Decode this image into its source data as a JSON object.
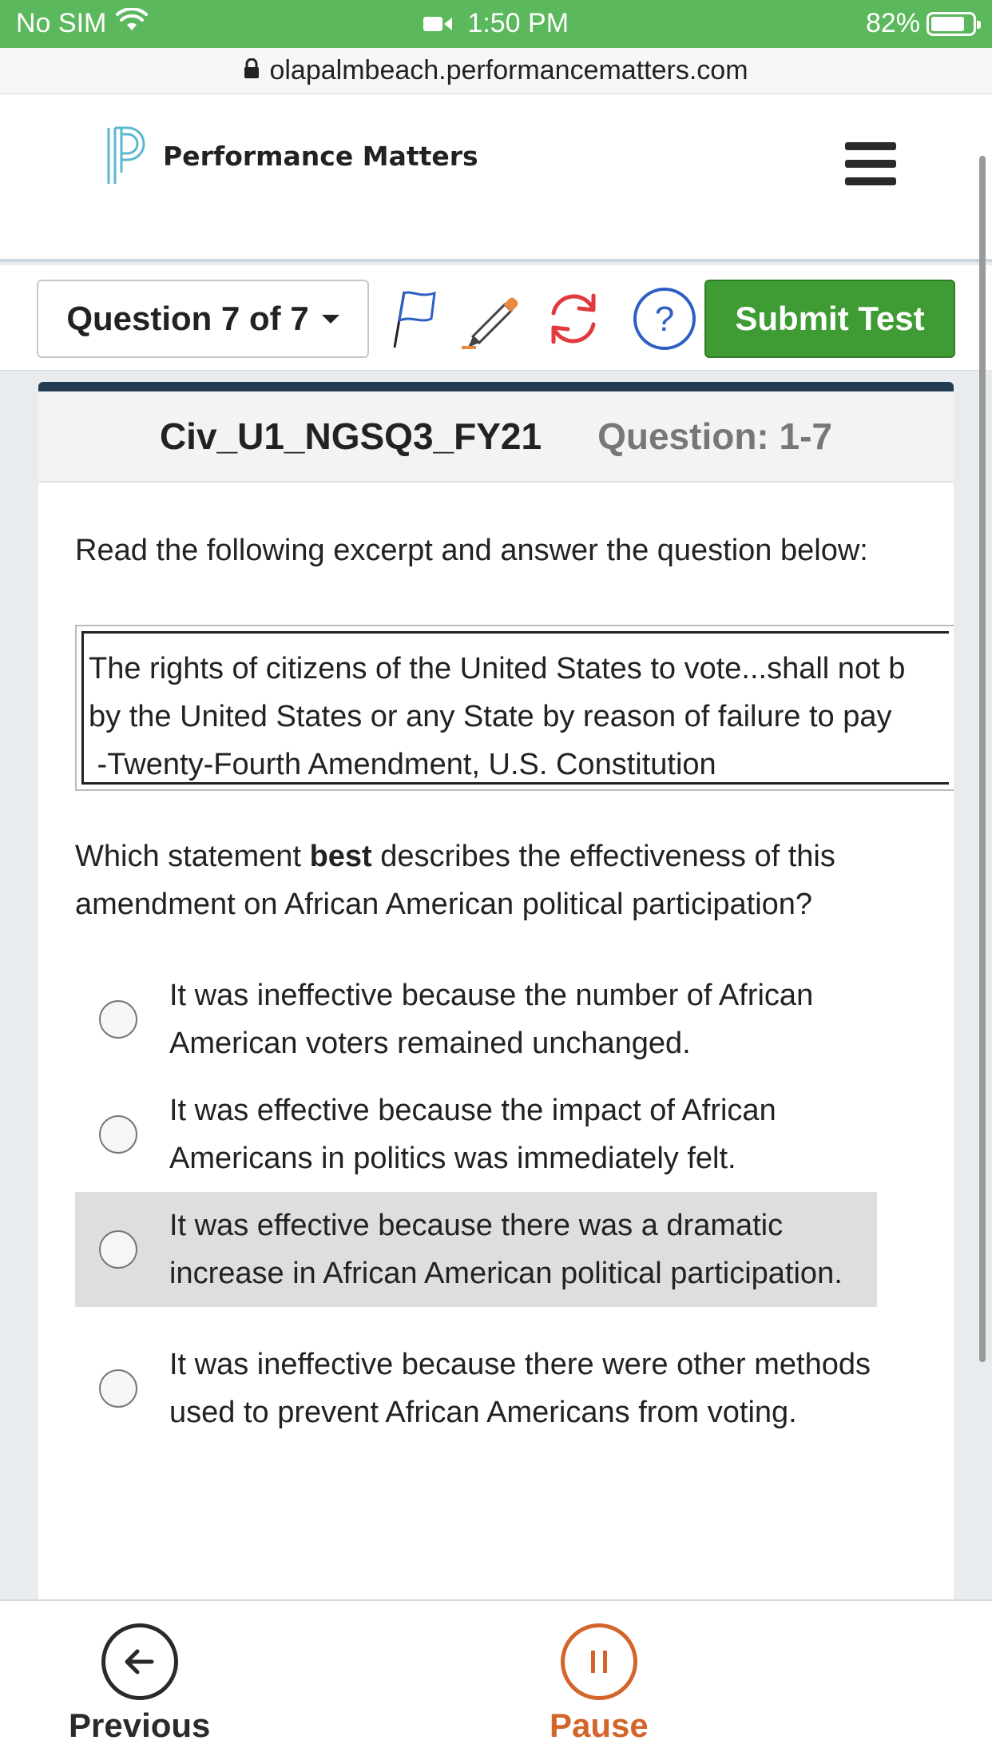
{
  "status_bar": {
    "carrier": "No SIM",
    "time": "1:50 PM",
    "battery": "82%",
    "battery_level": 0.82
  },
  "browser": {
    "url": "olapalmbeach.performancematters.com"
  },
  "header": {
    "logo_text": "Performance Matters",
    "menu_icon": "hamburger-menu-icon"
  },
  "toolbar": {
    "question_selector": "Question 7 of 7",
    "tools": [
      "flag-icon",
      "pencil-icon",
      "refresh-icon",
      "help-icon"
    ],
    "submit_label": "Submit Test",
    "accent_color": "#3f9c35"
  },
  "card": {
    "test_name": "Civ_U1_NGSQ3_FY21",
    "question_label": "Question: 1-7",
    "prompt": "Read the following excerpt and answer the question below:",
    "excerpt_lines": [
      "The rights of citizens of the United States to vote...shall not b",
      "by the United States or any State by reason of failure to pay",
      " -Twenty-Fourth Amendment, U.S. Constitution"
    ],
    "question_part1": "Which statement ",
    "question_bold": "best",
    "question_part2": " describes the effectiveness of this amendment on African American political participation?",
    "options": [
      "It was ineffective because the number of African American voters remained unchanged.",
      "It was effective because the impact of African Americans in politics was immediately felt.",
      "It was effective because there was a dramatic increase in African American political participation.",
      "It was ineffective because there were other methods used to prevent African Americans from voting."
    ]
  },
  "bottom_nav": {
    "previous_label": "Previous",
    "pause_label": "Pause",
    "pause_color": "#d4652a"
  }
}
